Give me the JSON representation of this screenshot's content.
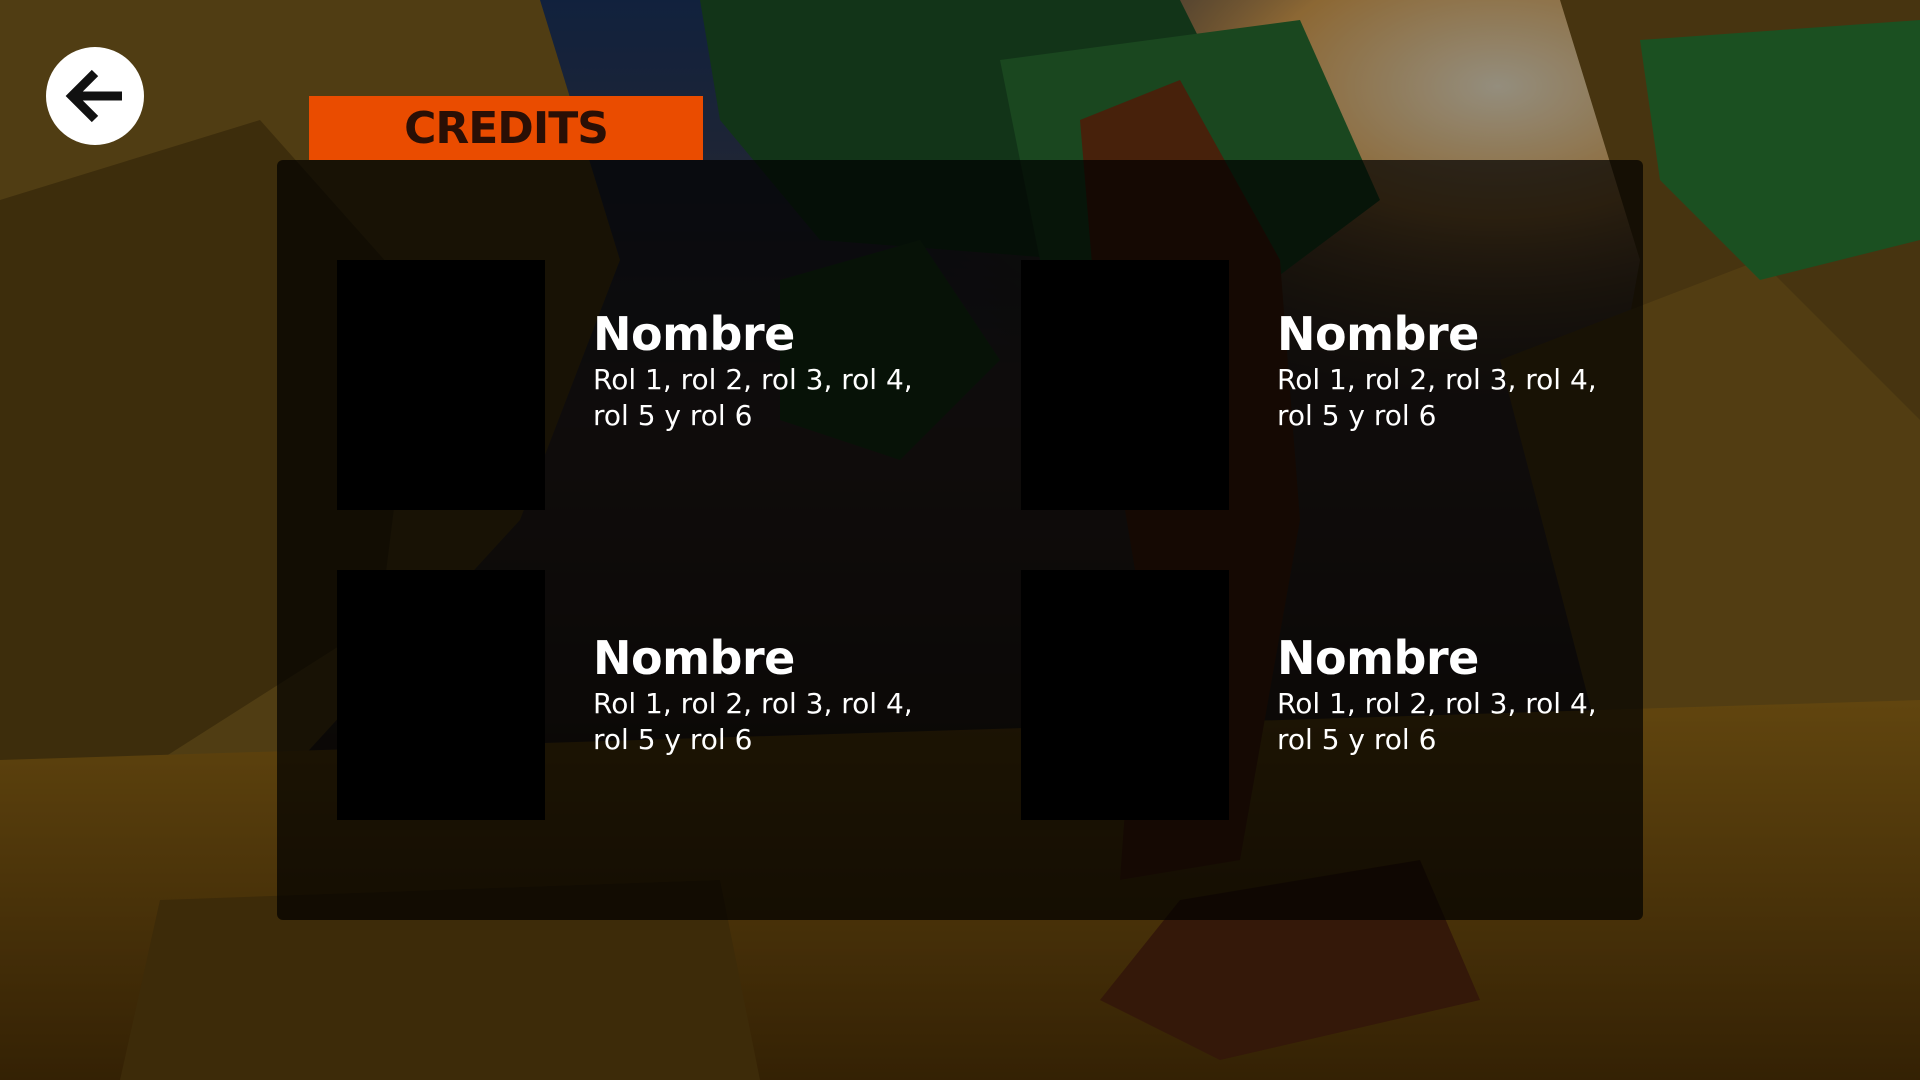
{
  "screen": {
    "title": "CREDITS",
    "accent_color": "#ea4c00",
    "back_icon": "arrow-left-icon"
  },
  "credits": [
    {
      "name": "Nombre",
      "roles": "Rol 1, rol 2, rol 3, rol 4, rol 5 y rol 6"
    },
    {
      "name": "Nombre",
      "roles": "Rol 1, rol 2, rol 3, rol 4, rol 5 y rol 6"
    },
    {
      "name": "Nombre",
      "roles": "Rol 1, rol 2, rol 3, rol 4, rol 5 y rol 6"
    },
    {
      "name": "Nombre",
      "roles": "Rol 1, rol 2, rol 3, rol 4, rol 5 y rol 6"
    }
  ]
}
